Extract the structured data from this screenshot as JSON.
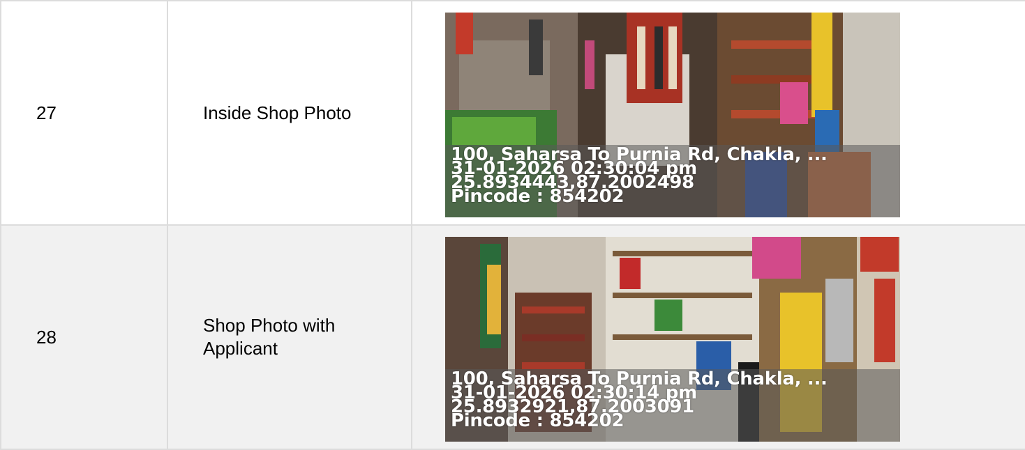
{
  "rows": [
    {
      "number": "27",
      "label": "Inside Shop Photo",
      "photo": {
        "address": "100, Saharsa To Purnia Rd, Chakla, ...",
        "datetime": "31-01-2026 02:30:04 pm",
        "coords": "25.8934443,87.2002498",
        "pincode": "Pincode : 854202"
      }
    },
    {
      "number": "28",
      "label": "Shop Photo with Applicant",
      "photo": {
        "address": "100, Saharsa To Purnia Rd, Chakla, ...",
        "datetime": "31-01-2026 02:30:14 pm",
        "coords": "25.8932921,87.2003091",
        "pincode": "Pincode : 854202"
      }
    }
  ]
}
